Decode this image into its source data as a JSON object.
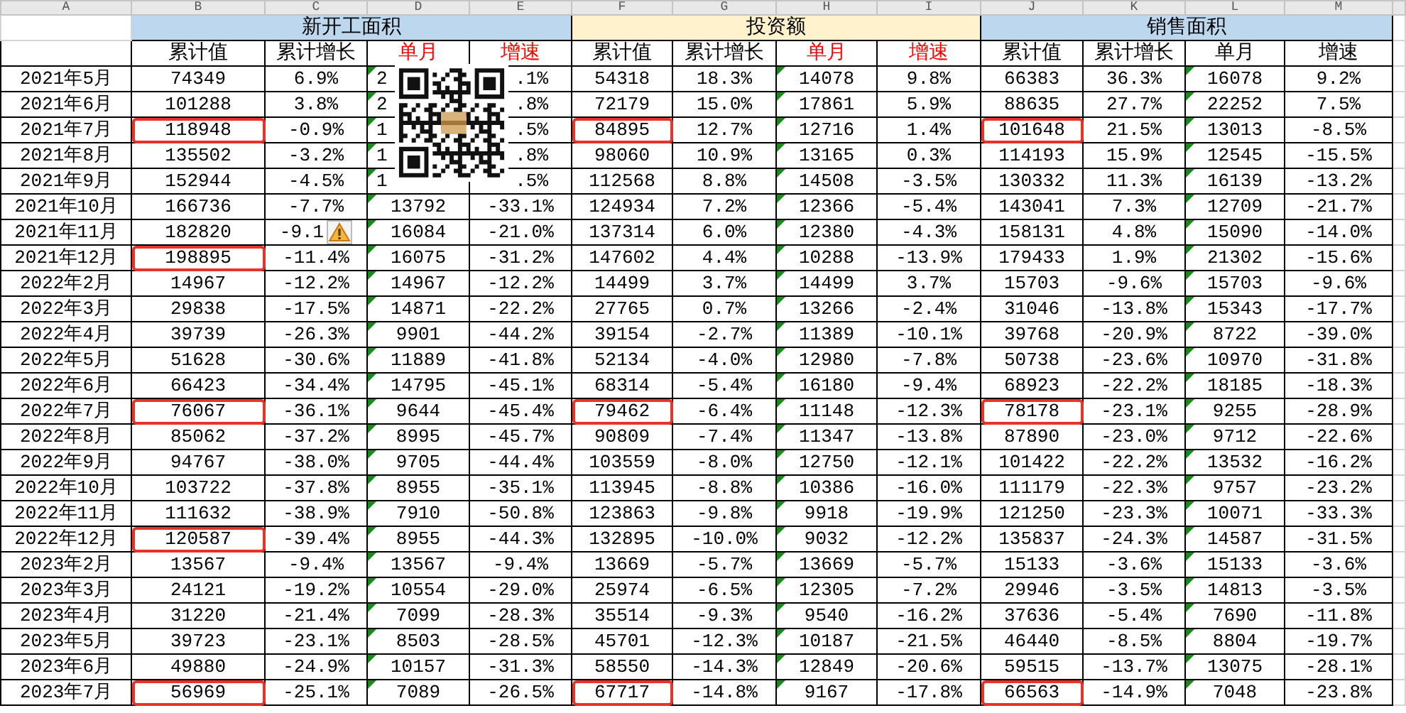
{
  "column_letters": [
    "A",
    "B",
    "C",
    "D",
    "E",
    "F",
    "G",
    "H",
    "I",
    "J",
    "K",
    "L",
    "M"
  ],
  "groups": [
    {
      "label": "新开工面积",
      "color": "#bdd7ee",
      "columns": [
        {
          "label": "累计值",
          "red": false,
          "flagged": false
        },
        {
          "label": "累计增长",
          "red": false,
          "flagged": false
        },
        {
          "label": "单月",
          "red": true,
          "flagged": true
        },
        {
          "label": "增速",
          "red": true,
          "flagged": false
        }
      ]
    },
    {
      "label": "投资额",
      "color": "#fff2cc",
      "columns": [
        {
          "label": "累计值",
          "red": false,
          "flagged": false
        },
        {
          "label": "累计增长",
          "red": false,
          "flagged": false
        },
        {
          "label": "单月",
          "red": true,
          "flagged": true
        },
        {
          "label": "增速",
          "red": true,
          "flagged": false
        }
      ]
    },
    {
      "label": "销售面积",
      "color": "#bdd7ee",
      "columns": [
        {
          "label": "累计值",
          "red": false,
          "flagged": false
        },
        {
          "label": "累计增长",
          "red": false,
          "flagged": false
        },
        {
          "label": "单月",
          "red": false,
          "flagged": true
        },
        {
          "label": "增速",
          "red": false,
          "flagged": false
        }
      ]
    }
  ],
  "rows": [
    {
      "label": "2021年5月",
      "cells": [
        "74349",
        "6.9%",
        {
          "text": "2",
          "cut_end": true
        },
        {
          "text": ".1%",
          "cut_start": true
        },
        "54318",
        "18.3%",
        "14078",
        "9.8%",
        "66383",
        "36.3%",
        "16078",
        "9.2%"
      ]
    },
    {
      "label": "2021年6月",
      "cells": [
        "101288",
        "3.8%",
        {
          "text": "2",
          "cut_end": true
        },
        {
          "text": ".8%",
          "cut_start": true
        },
        "72179",
        "15.0%",
        "17861",
        "5.9%",
        "88635",
        "27.7%",
        "22252",
        "7.5%"
      ]
    },
    {
      "label": "2021年7月",
      "cells": [
        {
          "text": "118948",
          "circled": true
        },
        "-0.9%",
        {
          "text": "1",
          "cut_end": true
        },
        {
          "text": ".5%",
          "cut_start": true
        },
        {
          "text": "84895",
          "circled": true
        },
        "12.7%",
        "12716",
        "1.4%",
        {
          "text": "101648",
          "circled": true
        },
        "21.5%",
        "13013",
        "-8.5%"
      ]
    },
    {
      "label": "2021年8月",
      "cells": [
        "135502",
        "-3.2%",
        {
          "text": "1",
          "cut_end": true
        },
        {
          "text": ".8%",
          "cut_start": true
        },
        "98060",
        "10.9%",
        "13165",
        "0.3%",
        "114193",
        "15.9%",
        "12545",
        "-15.5%"
      ]
    },
    {
      "label": "2021年9月",
      "cells": [
        "152944",
        "-4.5%",
        {
          "text": "1",
          "cut_end": true
        },
        {
          "text": ".5%",
          "cut_start": true
        },
        "112568",
        "8.8%",
        "14508",
        "-3.5%",
        "130332",
        "11.3%",
        "16139",
        "-13.2%"
      ]
    },
    {
      "label": "2021年10月",
      "cells": [
        "166736",
        "-7.7%",
        "13792",
        "-33.1%",
        "124934",
        "7.2%",
        "12366",
        "-5.4%",
        "143041",
        "7.3%",
        "12709",
        "-21.7%"
      ]
    },
    {
      "label": "2021年11月",
      "cells": [
        "182820",
        {
          "text": "-9.1",
          "warning": true
        },
        "16084",
        "-21.0%",
        "137314",
        "6.0%",
        "12380",
        "-4.3%",
        "158131",
        "4.8%",
        "15090",
        "-14.0%"
      ]
    },
    {
      "label": "2021年12月",
      "cells": [
        {
          "text": "198895",
          "circled": true
        },
        "-11.4%",
        "16075",
        "-31.2%",
        "147602",
        "4.4%",
        "10288",
        "-13.9%",
        "179433",
        "1.9%",
        "21302",
        "-15.6%"
      ]
    },
    {
      "label": "2022年2月",
      "cells": [
        "14967",
        "-12.2%",
        "14967",
        "-12.2%",
        "14499",
        "3.7%",
        "14499",
        "3.7%",
        "15703",
        "-9.6%",
        "15703",
        "-9.6%"
      ]
    },
    {
      "label": "2022年3月",
      "cells": [
        "29838",
        "-17.5%",
        "14871",
        "-22.2%",
        "27765",
        "0.7%",
        "13266",
        "-2.4%",
        "31046",
        "-13.8%",
        "15343",
        "-17.7%"
      ]
    },
    {
      "label": "2022年4月",
      "cells": [
        "39739",
        "-26.3%",
        "9901",
        "-44.2%",
        "39154",
        "-2.7%",
        "11389",
        "-10.1%",
        "39768",
        "-20.9%",
        "8722",
        "-39.0%"
      ]
    },
    {
      "label": "2022年5月",
      "cells": [
        "51628",
        "-30.6%",
        "11889",
        "-41.8%",
        "52134",
        "-4.0%",
        "12980",
        "-7.8%",
        "50738",
        "-23.6%",
        "10970",
        "-31.8%"
      ]
    },
    {
      "label": "2022年6月",
      "cells": [
        "66423",
        "-34.4%",
        "14795",
        "-45.1%",
        "68314",
        "-5.4%",
        "16180",
        "-9.4%",
        "68923",
        "-22.2%",
        "18185",
        "-18.3%"
      ]
    },
    {
      "label": "2022年7月",
      "cells": [
        {
          "text": "76067",
          "circled": true
        },
        "-36.1%",
        "9644",
        "-45.4%",
        {
          "text": "79462",
          "circled": true
        },
        "-6.4%",
        "11148",
        "-12.3%",
        {
          "text": "78178",
          "circled": true
        },
        "-23.1%",
        "9255",
        "-28.9%"
      ]
    },
    {
      "label": "2022年8月",
      "cells": [
        "85062",
        "-37.2%",
        "8995",
        "-45.7%",
        "90809",
        "-7.4%",
        "11347",
        "-13.8%",
        "87890",
        "-23.0%",
        "9712",
        "-22.6%"
      ]
    },
    {
      "label": "2022年9月",
      "cells": [
        "94767",
        "-38.0%",
        "9705",
        "-44.4%",
        "103559",
        "-8.0%",
        "12750",
        "-12.1%",
        "101422",
        "-22.2%",
        "13532",
        "-16.2%"
      ]
    },
    {
      "label": "2022年10月",
      "cells": [
        "103722",
        "-37.8%",
        "8955",
        "-35.1%",
        "113945",
        "-8.8%",
        "10386",
        "-16.0%",
        "111179",
        "-22.3%",
        "9757",
        "-23.2%"
      ]
    },
    {
      "label": "2022年11月",
      "cells": [
        "111632",
        "-38.9%",
        "7910",
        "-50.8%",
        "123863",
        "-9.8%",
        "9918",
        "-19.9%",
        "121250",
        "-23.3%",
        "10071",
        "-33.3%"
      ]
    },
    {
      "label": "2022年12月",
      "cells": [
        {
          "text": "120587",
          "circled": true
        },
        "-39.4%",
        "8955",
        "-44.3%",
        "132895",
        "-10.0%",
        "9032",
        "-12.2%",
        "135837",
        "-24.3%",
        "14587",
        "-31.5%"
      ]
    },
    {
      "label": "2023年2月",
      "cells": [
        "13567",
        "-9.4%",
        "13567",
        "-9.4%",
        "13669",
        "-5.7%",
        "13669",
        "-5.7%",
        "15133",
        "-3.6%",
        "15133",
        "-3.6%"
      ]
    },
    {
      "label": "2023年3月",
      "cells": [
        "24121",
        "-19.2%",
        "10554",
        "-29.0%",
        "25974",
        "-6.5%",
        "12305",
        "-7.2%",
        "29946",
        "-3.5%",
        "14813",
        "-3.5%"
      ]
    },
    {
      "label": "2023年4月",
      "cells": [
        "31220",
        "-21.4%",
        "7099",
        "-28.3%",
        "35514",
        "-9.3%",
        "9540",
        "-16.2%",
        "37636",
        "-5.4%",
        "7690",
        "-11.8%"
      ]
    },
    {
      "label": "2023年5月",
      "cells": [
        "39723",
        "-23.1%",
        "8503",
        "-28.5%",
        "45701",
        "-12.3%",
        "10187",
        "-21.5%",
        "46440",
        "-8.5%",
        "8804",
        "-19.7%"
      ]
    },
    {
      "label": "2023年6月",
      "cells": [
        "49880",
        "-24.9%",
        "10157",
        "-31.3%",
        "58550",
        "-14.3%",
        "12849",
        "-20.6%",
        "59515",
        "-13.7%",
        "13075",
        "-28.1%"
      ]
    },
    {
      "label": "2023年7月",
      "cells": [
        {
          "text": "56969",
          "circled": true
        },
        "-25.1%",
        "7089",
        "-26.5%",
        {
          "text": "67717",
          "circled": true
        },
        "-14.8%",
        "9167",
        "-17.8%",
        {
          "text": "66563",
          "circled": true
        },
        "-14.9%",
        "7048",
        "-23.8%"
      ]
    }
  ],
  "qr_code_overlay": true
}
